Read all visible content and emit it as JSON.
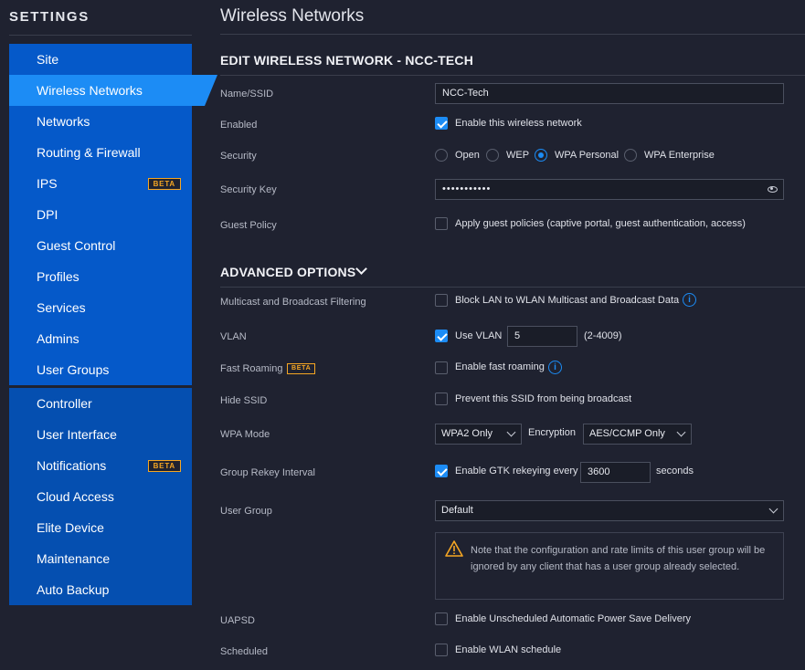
{
  "sidebar": {
    "title": "SETTINGS",
    "items": [
      {
        "label": "Site"
      },
      {
        "label": "Wireless Networks"
      },
      {
        "label": "Networks"
      },
      {
        "label": "Routing & Firewall"
      },
      {
        "label": "IPS",
        "badge": "BETA"
      },
      {
        "label": "DPI"
      },
      {
        "label": "Guest Control"
      },
      {
        "label": "Profiles"
      },
      {
        "label": "Services"
      },
      {
        "label": "Admins"
      },
      {
        "label": "User Groups"
      },
      {
        "label": "Controller"
      },
      {
        "label": "User Interface"
      },
      {
        "label": "Notifications",
        "badge": "BETA"
      },
      {
        "label": "Cloud Access"
      },
      {
        "label": "Elite Device"
      },
      {
        "label": "Maintenance"
      },
      {
        "label": "Auto Backup"
      }
    ],
    "active_item": "Wireless Networks"
  },
  "main": {
    "page_title": "Wireless Networks",
    "edit_header": "EDIT WIRELESS NETWORK - NCC-TECH",
    "advanced_header": "ADVANCED OPTIONS",
    "fields": {
      "ssid": {
        "label": "Name/SSID",
        "value": "NCC-Tech"
      },
      "enabled": {
        "label": "Enabled",
        "option": "Enable this wireless network",
        "checked": true
      },
      "security": {
        "label": "Security",
        "options": [
          "Open",
          "WEP",
          "WPA Personal",
          "WPA Enterprise"
        ],
        "selected": "WPA Personal"
      },
      "security_key": {
        "label": "Security Key",
        "value": "•••••••••••"
      },
      "guest_policy": {
        "label": "Guest Policy",
        "option": "Apply guest policies (captive portal, guest authentication, access)",
        "checked": false
      },
      "multicast": {
        "label": "Multicast and Broadcast Filtering",
        "option": "Block LAN to WLAN Multicast and Broadcast Data",
        "checked": false
      },
      "vlan": {
        "label": "VLAN",
        "option": "Use VLAN",
        "checked": true,
        "value": "5",
        "range": "(2-4009)"
      },
      "fast_roaming": {
        "label": "Fast Roaming",
        "badge": "BETA",
        "option": "Enable fast roaming",
        "checked": false
      },
      "hide_ssid": {
        "label": "Hide SSID",
        "option": "Prevent this SSID from being broadcast",
        "checked": false
      },
      "wpa_mode": {
        "label": "WPA Mode",
        "value": "WPA2 Only",
        "encryption_label": "Encryption",
        "encryption_value": "AES/CCMP Only"
      },
      "group_rekey": {
        "label": "Group Rekey Interval",
        "option": "Enable GTK rekeying every",
        "checked": true,
        "value": "3600",
        "unit": "seconds"
      },
      "user_group": {
        "label": "User Group",
        "value": "Default",
        "notice": "Note that the configuration and rate limits of this user group will be ignored by any client that has a user group already selected."
      },
      "uapsd": {
        "label": "UAPSD",
        "option": "Enable Unscheduled Automatic Power Save Delivery",
        "checked": false
      },
      "scheduled": {
        "label": "Scheduled",
        "option": "Enable WLAN schedule",
        "checked": false
      }
    }
  },
  "colors": {
    "background": "#1f2230",
    "nav_blue": "#0559c9",
    "nav_active": "#1c8cf5",
    "accent": "#1c8cf5",
    "beta": "#f5a623"
  }
}
